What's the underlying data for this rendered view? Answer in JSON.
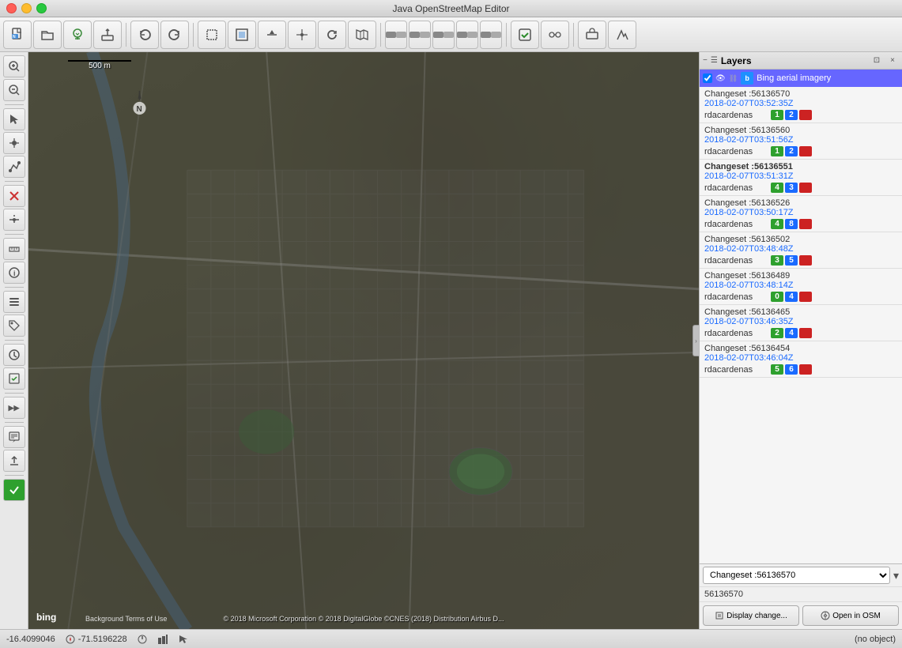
{
  "window": {
    "title": "Java OpenStreetMap Editor",
    "traffic_lights": [
      "red",
      "yellow",
      "green"
    ]
  },
  "toolbar": {
    "buttons": [
      {
        "name": "new",
        "icon": "📄",
        "label": "New"
      },
      {
        "name": "open",
        "icon": "📂",
        "label": "Open"
      },
      {
        "name": "download",
        "icon": "⬇️",
        "label": "Download"
      },
      {
        "name": "upload",
        "icon": "📤",
        "label": "Upload"
      },
      {
        "name": "undo",
        "icon": "↩",
        "label": "Undo"
      },
      {
        "name": "redo",
        "icon": "↪",
        "label": "Redo"
      },
      {
        "name": "select",
        "icon": "⬜",
        "label": "Select"
      },
      {
        "name": "zoom-fit",
        "icon": "⊞",
        "label": "Zoom Fit"
      },
      {
        "name": "move",
        "icon": "✂",
        "label": "Move"
      },
      {
        "name": "node",
        "icon": "⋯",
        "label": "Node"
      },
      {
        "name": "refresh",
        "icon": "⟳",
        "label": "Refresh"
      },
      {
        "name": "map",
        "icon": "🗺",
        "label": "Map"
      },
      {
        "name": "sep1",
        "type": "sep"
      },
      {
        "name": "toggle1",
        "icon": "▬",
        "label": "Toggle1"
      },
      {
        "name": "toggle2",
        "icon": "▬",
        "label": "Toggle2"
      },
      {
        "name": "toggle3",
        "icon": "▬",
        "label": "Toggle3"
      },
      {
        "name": "toggle4",
        "icon": "▬",
        "label": "Toggle4"
      },
      {
        "name": "toggle5",
        "icon": "▬",
        "label": "Toggle5"
      },
      {
        "name": "sep2",
        "type": "sep"
      },
      {
        "name": "tool1",
        "icon": "✏",
        "label": "Tool1"
      },
      {
        "name": "tool2",
        "icon": "🔧",
        "label": "Tool2"
      },
      {
        "name": "sep3",
        "type": "sep"
      },
      {
        "name": "validate",
        "icon": "☑",
        "label": "Validate"
      },
      {
        "name": "relations",
        "icon": "🔗",
        "label": "Relations"
      }
    ]
  },
  "left_toolbar": {
    "buttons": [
      {
        "name": "zoom-in",
        "icon": "🔍",
        "label": "Zoom In"
      },
      {
        "name": "zoom-out",
        "icon": "🔎",
        "label": "Zoom Out"
      },
      {
        "name": "select-tool",
        "icon": "↖",
        "label": "Select"
      },
      {
        "name": "draw-node",
        "icon": "•",
        "label": "Draw Node"
      },
      {
        "name": "draw-way",
        "icon": "/",
        "label": "Draw Way"
      },
      {
        "name": "sep"
      },
      {
        "name": "delete",
        "icon": "✕",
        "label": "Delete"
      },
      {
        "name": "split",
        "icon": "✂",
        "label": "Split"
      },
      {
        "name": "sep2"
      },
      {
        "name": "measure",
        "icon": "📏",
        "label": "Measure"
      },
      {
        "name": "info",
        "icon": "ℹ",
        "label": "Info"
      },
      {
        "name": "sep3"
      },
      {
        "name": "layers",
        "icon": "☰",
        "label": "Layers"
      },
      {
        "name": "tags",
        "icon": "🏷",
        "label": "Tags"
      },
      {
        "name": "sep4"
      },
      {
        "name": "history",
        "icon": "⏱",
        "label": "History"
      },
      {
        "name": "todo",
        "icon": "✓",
        "label": "Todo"
      },
      {
        "name": "sep5"
      },
      {
        "name": "play",
        "icon": "▶▶",
        "label": "Play"
      },
      {
        "name": "sep6"
      },
      {
        "name": "notes",
        "icon": "📝",
        "label": "Notes"
      },
      {
        "name": "upload2",
        "icon": "⬆",
        "label": "Upload"
      },
      {
        "name": "sep7"
      },
      {
        "name": "checkmark",
        "icon": "✔",
        "label": "Checkmark"
      }
    ]
  },
  "layers_panel": {
    "title": "Layers",
    "bing_layer": {
      "label": "Bing aerial imagery",
      "active": true
    }
  },
  "changesets": [
    {
      "id": "56136570",
      "date": "2018-02-07T03:52:35Z",
      "user": "rdacardenas",
      "badges": [
        {
          "value": "1",
          "color": "green"
        },
        {
          "value": "2",
          "color": "blue"
        },
        {
          "value": "",
          "color": "red"
        }
      ]
    },
    {
      "id": "56136560",
      "date": "2018-02-07T03:51:56Z",
      "user": "rdacardenas",
      "badges": [
        {
          "value": "1",
          "color": "green"
        },
        {
          "value": "2",
          "color": "blue"
        },
        {
          "value": "",
          "color": "red"
        }
      ]
    },
    {
      "id": "56136551",
      "date": "2018-02-07T03:51:31Z",
      "user": "rdacardenas",
      "badges": [
        {
          "value": "4",
          "color": "green"
        },
        {
          "value": "3",
          "color": "blue"
        },
        {
          "value": "",
          "color": "red"
        }
      ],
      "bold": true
    },
    {
      "id": "56136526",
      "date": "2018-02-07T03:50:17Z",
      "user": "rdacardenas",
      "badges": [
        {
          "value": "4",
          "color": "green"
        },
        {
          "value": "8",
          "color": "blue"
        },
        {
          "value": "",
          "color": "red"
        }
      ]
    },
    {
      "id": "56136502",
      "date": "2018-02-07T03:48:48Z",
      "user": "rdacardenas",
      "badges": [
        {
          "value": "3",
          "color": "green"
        },
        {
          "value": "5",
          "color": "blue"
        },
        {
          "value": "",
          "color": "red"
        }
      ]
    },
    {
      "id": "56136489",
      "date": "2018-02-07T03:48:14Z",
      "user": "rdacardenas",
      "badges": [
        {
          "value": "0",
          "color": "green"
        },
        {
          "value": "4",
          "color": "blue"
        },
        {
          "value": "",
          "color": "red"
        }
      ]
    },
    {
      "id": "56136465",
      "date": "2018-02-07T03:46:35Z",
      "user": "rdacardenas",
      "badges": [
        {
          "value": "2",
          "color": "green"
        },
        {
          "value": "4",
          "color": "blue"
        },
        {
          "value": "",
          "color": "red"
        }
      ]
    },
    {
      "id": "56136454",
      "date": "2018-02-07T03:46:04Z",
      "user": "rdacardenas",
      "badges": [
        {
          "value": "5",
          "color": "green"
        },
        {
          "value": "6",
          "color": "blue"
        },
        {
          "value": "",
          "color": "red"
        }
      ]
    }
  ],
  "bottom": {
    "selected_changeset": "56136570",
    "changeset_id": "56136570",
    "display_changes_btn": "Display change...",
    "open_in_osm_btn": "Open in OSM"
  },
  "statusbar": {
    "lat": "-16.4099046",
    "lon": "-71.5196228",
    "heading_icon": "compass",
    "zoom_icon": "zoom",
    "status": "(no object)"
  },
  "map": {
    "scale_text": "500 m",
    "copyright": "© 2018 Microsoft Corporation © 2018 DigitalGlobe ©CNES (2018) Distribution Airbus D...",
    "terms": "Background Terms of Use",
    "bing_logo": "bing"
  }
}
